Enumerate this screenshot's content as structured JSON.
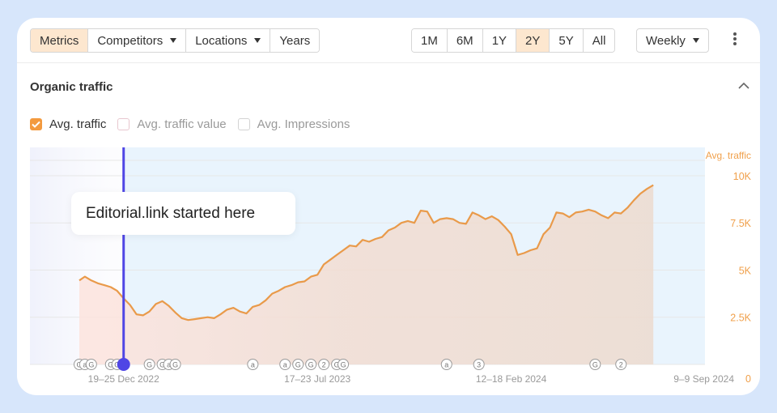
{
  "toolbar": {
    "left_tabs": [
      {
        "label": "Metrics",
        "active": true
      },
      {
        "label": "Competitors",
        "dropdown": true
      },
      {
        "label": "Locations",
        "dropdown": true
      },
      {
        "label": "Years"
      }
    ],
    "range_tabs": [
      {
        "label": "1M"
      },
      {
        "label": "6M"
      },
      {
        "label": "1Y"
      },
      {
        "label": "2Y",
        "active": true
      },
      {
        "label": "5Y"
      },
      {
        "label": "All"
      }
    ],
    "interval": "Weekly",
    "menu_icon": "more-vertical-icon"
  },
  "section": {
    "title": "Organic traffic",
    "collapse_icon": "chevron-up-icon"
  },
  "legend": [
    {
      "label": "Avg. traffic",
      "checked": true
    },
    {
      "label": "Avg. traffic value",
      "checked": false
    },
    {
      "label": "Avg. Impressions",
      "checked": false
    }
  ],
  "callout": {
    "text": "Editorial.link started here"
  },
  "colors": {
    "line": "#e99a4a",
    "highlight": "#e9f4fd",
    "marker": "#4f46e5",
    "axis_text": "#f0a04b",
    "active_bg": "#fde7cf"
  },
  "chart_data": {
    "type": "area",
    "y_axis_title": "Avg. traffic",
    "y_ticks": [
      "0",
      "2.5K",
      "5K",
      "7.5K",
      "10K"
    ],
    "ylim": [
      0,
      11500
    ],
    "x_range": [
      "2022-11-01",
      "2024-09-09"
    ],
    "x_tick_labels": [
      "19–25 Dec 2022",
      "17–23 Jul 2023",
      "12–18 Feb 2024",
      "9–9 Sep 2024"
    ],
    "x_tick_dates": [
      "2022-12-19",
      "2023-07-17",
      "2024-02-12",
      "2024-09-09"
    ],
    "highlight_start": "2022-12-19",
    "marker_date": "2022-12-19",
    "grid": true,
    "series": [
      {
        "name": "Avg. traffic",
        "points": [
          [
            "2022-11-01",
            4450
          ],
          [
            "2022-11-07",
            4650
          ],
          [
            "2022-11-14",
            4450
          ],
          [
            "2022-11-21",
            4300
          ],
          [
            "2022-11-28",
            4200
          ],
          [
            "2022-12-05",
            4100
          ],
          [
            "2022-12-12",
            3900
          ],
          [
            "2022-12-19",
            3500
          ],
          [
            "2022-12-26",
            3150
          ],
          [
            "2023-01-02",
            2650
          ],
          [
            "2023-01-09",
            2600
          ],
          [
            "2023-01-16",
            2800
          ],
          [
            "2023-01-23",
            3200
          ],
          [
            "2023-01-30",
            3350
          ],
          [
            "2023-02-06",
            3100
          ],
          [
            "2023-02-13",
            2750
          ],
          [
            "2023-02-20",
            2450
          ],
          [
            "2023-02-27",
            2350
          ],
          [
            "2023-03-06",
            2400
          ],
          [
            "2023-03-13",
            2450
          ],
          [
            "2023-03-20",
            2500
          ],
          [
            "2023-03-27",
            2450
          ],
          [
            "2023-04-03",
            2650
          ],
          [
            "2023-04-10",
            2900
          ],
          [
            "2023-04-17",
            3000
          ],
          [
            "2023-04-24",
            2800
          ],
          [
            "2023-05-01",
            2700
          ],
          [
            "2023-05-08",
            3050
          ],
          [
            "2023-05-15",
            3150
          ],
          [
            "2023-05-22",
            3400
          ],
          [
            "2023-05-29",
            3750
          ],
          [
            "2023-06-05",
            3900
          ],
          [
            "2023-06-12",
            4100
          ],
          [
            "2023-06-19",
            4200
          ],
          [
            "2023-06-26",
            4350
          ],
          [
            "2023-07-03",
            4400
          ],
          [
            "2023-07-10",
            4650
          ],
          [
            "2023-07-17",
            4750
          ],
          [
            "2023-07-24",
            5300
          ],
          [
            "2023-07-31",
            5550
          ],
          [
            "2023-08-07",
            5800
          ],
          [
            "2023-08-14",
            6050
          ],
          [
            "2023-08-21",
            6300
          ],
          [
            "2023-08-28",
            6250
          ],
          [
            "2023-09-04",
            6600
          ],
          [
            "2023-09-11",
            6500
          ],
          [
            "2023-09-18",
            6650
          ],
          [
            "2023-09-25",
            6750
          ],
          [
            "2023-10-02",
            7100
          ],
          [
            "2023-10-09",
            7250
          ],
          [
            "2023-10-16",
            7500
          ],
          [
            "2023-10-23",
            7600
          ],
          [
            "2023-10-30",
            7500
          ],
          [
            "2023-11-06",
            8150
          ],
          [
            "2023-11-13",
            8100
          ],
          [
            "2023-11-20",
            7500
          ],
          [
            "2023-11-27",
            7700
          ],
          [
            "2023-12-04",
            7750
          ],
          [
            "2023-12-11",
            7700
          ],
          [
            "2023-12-18",
            7500
          ],
          [
            "2023-12-25",
            7450
          ],
          [
            "2024-01-01",
            8050
          ],
          [
            "2024-01-08",
            7900
          ],
          [
            "2024-01-15",
            7700
          ],
          [
            "2024-01-22",
            7850
          ],
          [
            "2024-01-29",
            7650
          ],
          [
            "2024-02-05",
            7300
          ],
          [
            "2024-02-12",
            6900
          ],
          [
            "2024-02-19",
            5800
          ],
          [
            "2024-02-26",
            5900
          ],
          [
            "2024-03-04",
            6050
          ],
          [
            "2024-03-11",
            6150
          ],
          [
            "2024-03-18",
            6900
          ],
          [
            "2024-03-25",
            7250
          ],
          [
            "2024-04-01",
            8050
          ],
          [
            "2024-04-08",
            8000
          ],
          [
            "2024-04-15",
            7800
          ],
          [
            "2024-04-22",
            8050
          ],
          [
            "2024-04-29",
            8100
          ],
          [
            "2024-05-06",
            8200
          ],
          [
            "2024-05-13",
            8100
          ],
          [
            "2024-05-20",
            7900
          ],
          [
            "2024-05-27",
            7750
          ],
          [
            "2024-06-03",
            8050
          ],
          [
            "2024-06-10",
            8000
          ],
          [
            "2024-06-17",
            8300
          ],
          [
            "2024-06-24",
            8700
          ],
          [
            "2024-07-01",
            9050
          ],
          [
            "2024-07-08",
            9300
          ],
          [
            "2024-07-15",
            9500
          ]
        ]
      }
    ],
    "annotations": [
      {
        "date": "2022-11-01",
        "label": "G"
      },
      {
        "date": "2022-11-07",
        "label": "a"
      },
      {
        "date": "2022-11-14",
        "label": "G"
      },
      {
        "date": "2022-12-05",
        "label": "G"
      },
      {
        "date": "2022-12-12",
        "label": "G"
      },
      {
        "date": "2023-01-16",
        "label": "G"
      },
      {
        "date": "2023-01-30",
        "label": "G"
      },
      {
        "date": "2023-02-06",
        "label": "a"
      },
      {
        "date": "2023-02-13",
        "label": "G"
      },
      {
        "date": "2023-05-08",
        "label": "a"
      },
      {
        "date": "2023-06-12",
        "label": "a"
      },
      {
        "date": "2023-06-26",
        "label": "G"
      },
      {
        "date": "2023-07-10",
        "label": "G"
      },
      {
        "date": "2023-07-24",
        "label": "2"
      },
      {
        "date": "2023-08-07",
        "label": "G"
      },
      {
        "date": "2023-08-14",
        "label": "G"
      },
      {
        "date": "2023-12-04",
        "label": "a"
      },
      {
        "date": "2024-01-08",
        "label": "3"
      },
      {
        "date": "2024-05-13",
        "label": "G"
      },
      {
        "date": "2024-06-10",
        "label": "2"
      }
    ]
  }
}
